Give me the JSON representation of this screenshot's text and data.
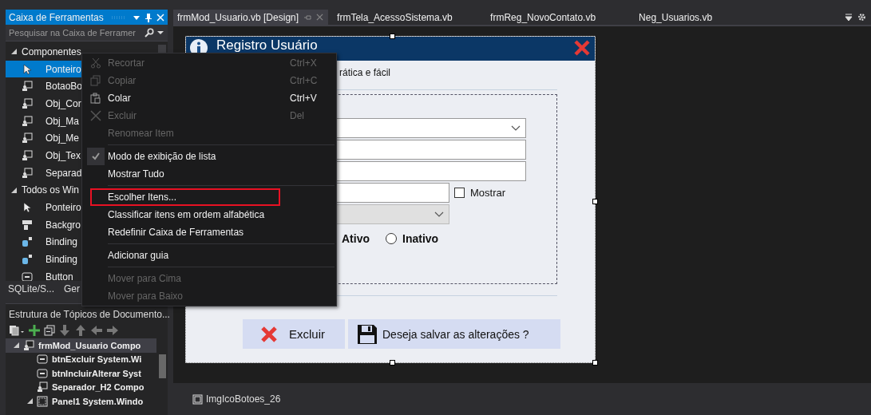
{
  "toolbox": {
    "title": "Caixa de Ferramentas",
    "search": {
      "placeholder": "Pesquisar na Caixa de Ferramer"
    },
    "groups": [
      {
        "label": "Componentes",
        "expanded": true,
        "items": [
          {
            "label": "Ponteiro",
            "kind": "pointer",
            "selected": true
          },
          {
            "label": "BotaoBo",
            "kind": "component",
            "selected": false
          },
          {
            "label": "Obj_Cor",
            "kind": "component",
            "selected": false
          },
          {
            "label": "Obj_Ma",
            "kind": "component",
            "selected": false
          },
          {
            "label": "Obj_Me",
            "kind": "component",
            "selected": false
          },
          {
            "label": "Obj_Tex",
            "kind": "component",
            "selected": false
          },
          {
            "label": "Separad",
            "kind": "component",
            "selected": false
          }
        ]
      },
      {
        "label": "Todos os Win",
        "expanded": true,
        "items": [
          {
            "label": "Ponteiro",
            "kind": "pointer",
            "selected": false
          },
          {
            "label": "Backgro",
            "kind": "background",
            "selected": false
          },
          {
            "label": "Binding",
            "kind": "binding",
            "selected": false
          },
          {
            "label": "Binding",
            "kind": "binding",
            "selected": false
          },
          {
            "label": "Button",
            "kind": "button",
            "selected": false
          }
        ]
      }
    ],
    "tabs": [
      {
        "label": "SQLite/S...",
        "selected": false
      },
      {
        "label": "Ger",
        "selected": false
      }
    ]
  },
  "document_outline": {
    "title": "Estrutura de Tópicos de Documento...",
    "tree": [
      {
        "label": "frmMod_Usuario  Compo",
        "kind": "component",
        "expanded": true,
        "selected": true,
        "children": [
          {
            "label": "btnExcluir  System.Wi",
            "kind": "button",
            "selected": false
          },
          {
            "label": "btnIncluirAlterar  Syst",
            "kind": "button",
            "selected": false
          },
          {
            "label": "Separador_H2  Compo",
            "kind": "component",
            "selected": false
          },
          {
            "label": "Panel1  System.Windo",
            "kind": "panel",
            "expanded": true,
            "selected": false
          }
        ]
      }
    ]
  },
  "context_menu": {
    "items": [
      {
        "kind": "item",
        "label": "Recortar",
        "shortcut": "Ctrl+X",
        "disabled": true,
        "checked": false,
        "outlined": false
      },
      {
        "kind": "item",
        "label": "Copiar",
        "shortcut": "Ctrl+C",
        "disabled": true,
        "checked": false,
        "outlined": false
      },
      {
        "kind": "item",
        "label": "Colar",
        "shortcut": "Ctrl+V",
        "disabled": false,
        "checked": false,
        "outlined": false
      },
      {
        "kind": "item",
        "label": "Excluir",
        "shortcut": "Del",
        "disabled": true,
        "checked": false,
        "outlined": false
      },
      {
        "kind": "item",
        "label": "Renomear Item",
        "disabled": true,
        "checked": false,
        "outlined": false
      },
      {
        "kind": "separator"
      },
      {
        "kind": "item",
        "label": "Modo de exibição de lista",
        "disabled": false,
        "checked": true,
        "outlined": false
      },
      {
        "kind": "item",
        "label": "Mostrar Tudo",
        "disabled": false,
        "checked": false,
        "outlined": false
      },
      {
        "kind": "separator"
      },
      {
        "kind": "item",
        "label": "Escolher Itens...",
        "disabled": false,
        "checked": false,
        "outlined": true
      },
      {
        "kind": "item",
        "label": "Classificar itens em ordem alfabética",
        "disabled": false,
        "checked": false,
        "outlined": false
      },
      {
        "kind": "item",
        "label": "Redefinir Caixa de Ferramentas",
        "disabled": false,
        "checked": false,
        "outlined": false
      },
      {
        "kind": "separator"
      },
      {
        "kind": "item",
        "label": "Adicionar guia",
        "disabled": false,
        "checked": false,
        "outlined": false
      },
      {
        "kind": "separator"
      },
      {
        "kind": "item",
        "label": "Mover para Cima",
        "disabled": true,
        "checked": false,
        "outlined": false
      },
      {
        "kind": "item",
        "label": "Mover para Baixo",
        "disabled": true,
        "checked": false,
        "outlined": false
      }
    ]
  },
  "editor_tabs": [
    {
      "label": "frmMod_Usuario.vb [Design]",
      "selected": true
    },
    {
      "label": "frmTela_AcessoSistema.vb",
      "selected": false
    },
    {
      "label": "frmReg_NovoContato.vb",
      "selected": false
    },
    {
      "label": "Neg_Usuarios.vb",
      "selected": false
    }
  ],
  "form": {
    "title": "Registro Usuário",
    "subtitle": "rática e fácil",
    "fields": [
      {
        "kind": "combo",
        "disabled": false
      },
      {
        "kind": "text",
        "disabled": false
      },
      {
        "kind": "text",
        "disabled": false
      },
      {
        "kind": "password",
        "disabled": false,
        "checkbox": {
          "label": "Mostrar",
          "checked": false
        }
      },
      {
        "kind": "combo",
        "disabled": true
      }
    ],
    "status_options": [
      {
        "kind": "label",
        "label": "Ativo"
      },
      {
        "kind": "radio",
        "label": "Inativo",
        "selected": false
      }
    ],
    "buttons": [
      {
        "label": "Excluir"
      },
      {
        "label": "Deseja salvar as alterações ?"
      }
    ]
  },
  "component_tray": [
    {
      "label": "ImgIcoBotoes_26"
    }
  ]
}
